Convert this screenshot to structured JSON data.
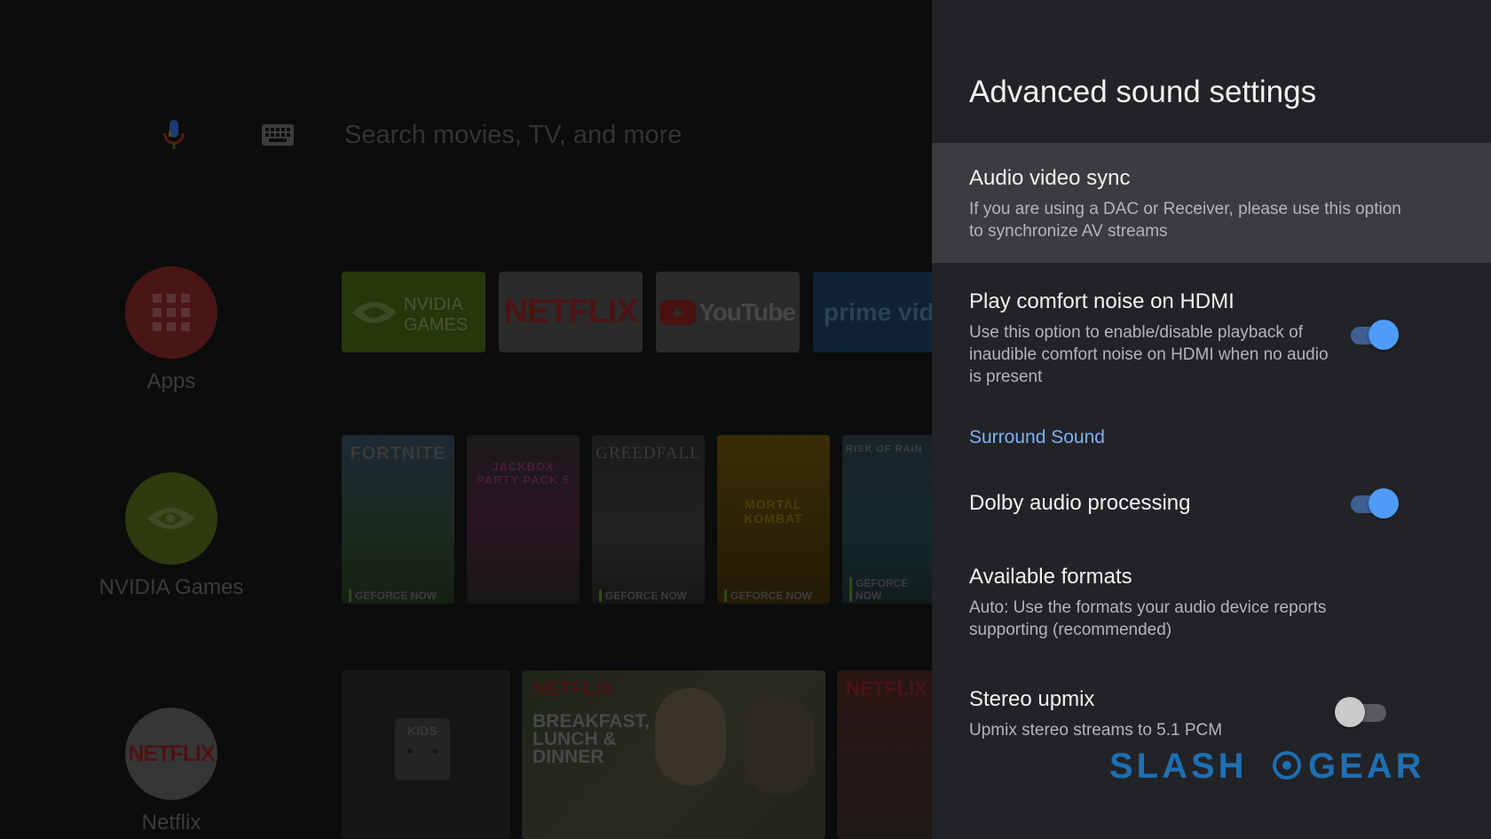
{
  "home": {
    "search_placeholder": "Search movies, TV, and more",
    "sidebar": [
      {
        "label": "Apps",
        "icon": "apps-grid-icon",
        "color": "#4a1615"
      },
      {
        "label": "NVIDIA Games",
        "icon": "nvidia-icon",
        "color": "#2f3a0f"
      },
      {
        "label": "Netflix",
        "icon": "netflix-icon",
        "color": "#363636"
      }
    ],
    "apps": [
      {
        "name": "NVIDIA GAMES",
        "icon": "nvidia-games-logo"
      },
      {
        "name": "NETFLIX",
        "icon": "netflix-logo"
      },
      {
        "name": "YouTube",
        "icon": "youtube-logo"
      },
      {
        "name": "prime video",
        "icon": "prime-video-logo"
      }
    ],
    "games": [
      {
        "title": "FORTNITE",
        "badge": "GEFORCE NOW"
      },
      {
        "title": "JACKBOX PARTY PACK 5",
        "badge": ""
      },
      {
        "title": "GREEDFALL",
        "badge": "GEFORCE NOW"
      },
      {
        "title": "MORTAL KOMBAT",
        "badge": "GEFORCE NOW"
      },
      {
        "title": "RISK OF RAIN",
        "badge": "GEFORCE NOW"
      }
    ],
    "bottom_row": [
      {
        "title": "KIDS"
      },
      {
        "title": "BREAKFAST, LUNCH & DINNER",
        "brand": "NETFLIX"
      },
      {
        "title": "",
        "brand": "NETFLIX"
      }
    ]
  },
  "panel": {
    "title": "Advanced sound settings",
    "items": [
      {
        "title": "Audio video sync",
        "description_lines": [
          "If you are using a DAC or Receiver, please use this option",
          "to synchronize AV streams"
        ],
        "selected": true
      },
      {
        "title": "Play comfort noise on HDMI",
        "description_lines": [
          "Use this option to enable/disable playback of",
          "inaudible comfort noise on HDMI when no audio",
          "is present"
        ],
        "toggle": true
      }
    ],
    "section_header": "Surround Sound",
    "surround_items": [
      {
        "title": "Dolby audio processing",
        "toggle": true
      },
      {
        "title": "Available formats",
        "description_lines": [
          "Auto: Use the formats your audio device reports",
          "supporting (recommended)"
        ]
      },
      {
        "title": "Stereo upmix",
        "description_lines": [
          "Upmix stereo streams to 5.1 PCM"
        ],
        "toggle": false
      }
    ]
  },
  "watermark": {
    "text": "SLASHGEAR",
    "color": "#1f6fb3"
  },
  "colors": {
    "accent": "#4f9bf7",
    "panel_bg": "#222326",
    "selected_bg": "#3b3c3f"
  }
}
